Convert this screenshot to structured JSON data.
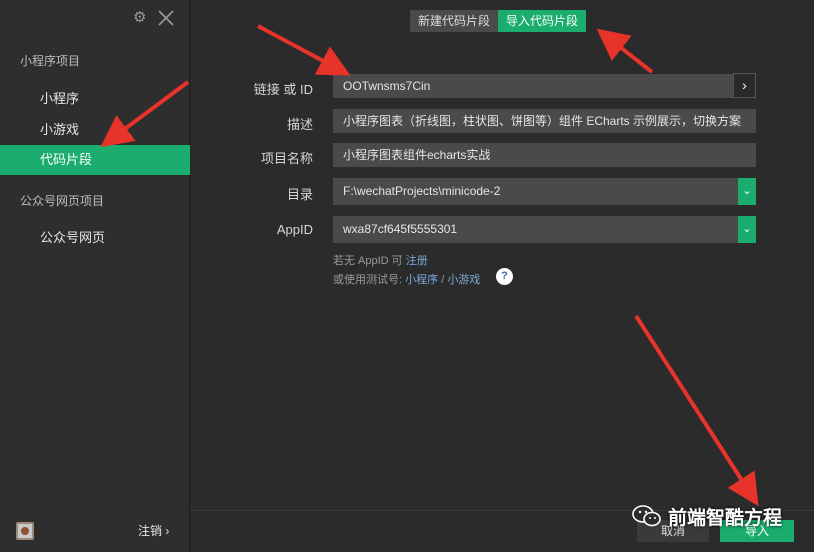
{
  "sidebar": {
    "gear_glyph": "⚙",
    "sections": [
      {
        "title": "小程序项目",
        "items": [
          "小程序",
          "小游戏",
          "代码片段"
        ]
      },
      {
        "title": "公众号网页项目",
        "items": [
          "公众号网页"
        ]
      }
    ],
    "active_item": "代码片段",
    "logout_label": "注销 ›"
  },
  "tabs": {
    "new_label": "新建代码片段",
    "import_label": "导入代码片段",
    "active": "import"
  },
  "form": {
    "link_label": "链接 或 ID",
    "link_value": "OOTwnsms7Cin",
    "go_glyph": "›",
    "desc_label": "描述",
    "desc_value": "小程序图表（折线图，柱状图、饼图等）组件 ECharts 示例展示，切换方案",
    "name_label": "项目名称",
    "name_value": "小程序图表组件echarts实战",
    "dir_label": "目录",
    "dir_value": "F:\\wechatProjects\\minicode-2",
    "appid_label": "AppID",
    "appid_value": "wxa87cf645f5555301",
    "dropdown_glyph": "⌄",
    "hint1_prefix": "若无 AppID 可",
    "hint1_link": "注册",
    "hint2_prefix": "或使用测试号:",
    "hint2_link1": "小程序",
    "hint2_sep": "/",
    "hint2_link2": "小游戏",
    "help_glyph": "?"
  },
  "footer": {
    "cancel_label": "取消",
    "import_label": "导入"
  },
  "watermark": {
    "text": "前端智酷方程"
  },
  "colors": {
    "accent": "#1aad6d",
    "background": "#2b2b2b",
    "field": "#4a4a4a",
    "annotation_arrow": "#e8332a"
  }
}
